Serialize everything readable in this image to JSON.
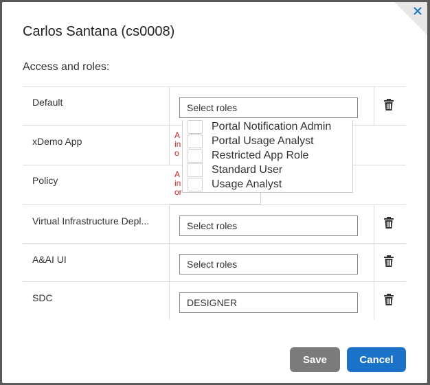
{
  "dialog": {
    "title": "Carlos Santana (cs0008)",
    "subtitle": "Access and roles:"
  },
  "rows": [
    {
      "app": "Default",
      "roles_value": "Select roles"
    },
    {
      "app": "xDemo App",
      "error_text": "A\nin\no"
    },
    {
      "app": "Policy",
      "error_text": "A\nin\nor"
    },
    {
      "app": "Virtual Infrastructure Depl...",
      "roles_value": "Select roles"
    },
    {
      "app": "A&AI UI",
      "roles_value": "Select roles"
    },
    {
      "app": "SDC",
      "roles_value": "DESIGNER"
    }
  ],
  "dropdown": {
    "options": [
      "Portal Notification Admin",
      "Portal Usage Analyst",
      "Restricted App Role",
      "Standard User",
      "Usage Analyst"
    ]
  },
  "buttons": {
    "save": "Save",
    "cancel": "Cancel"
  },
  "colors": {
    "save": "#7b7b7b",
    "cancel": "#1a73c8",
    "close_icon": "#1a73c8",
    "error": "#cc2222"
  },
  "icons": {
    "close": "close-icon",
    "delete": "trash-icon"
  }
}
